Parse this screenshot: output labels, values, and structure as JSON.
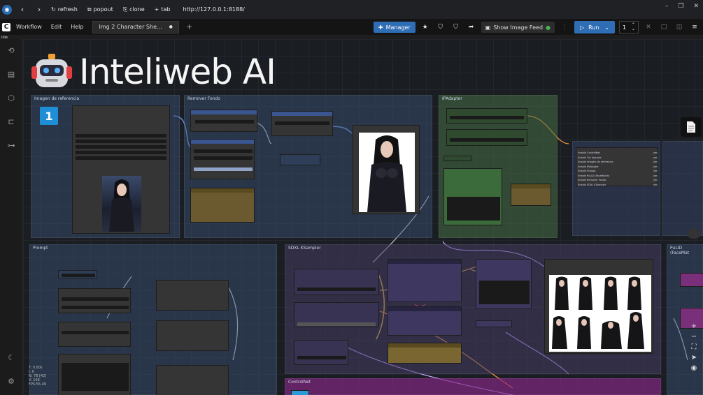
{
  "browser": {
    "back": "‹",
    "forward": "›",
    "buttons": [
      {
        "label": "refresh",
        "icon": "↻"
      },
      {
        "label": "popout",
        "icon": "⧉"
      },
      {
        "label": "clone",
        "icon": "⎘"
      },
      {
        "label": "tab",
        "icon": "+"
      }
    ],
    "url": "http://127.0.0.1:8188/",
    "window_controls": [
      "–",
      "❐",
      "✕"
    ]
  },
  "menubar": {
    "logo": "C",
    "items": [
      "Workflow",
      "Edit",
      "Help"
    ],
    "tab_label": "Img 2 Character She...",
    "tab_modified": "●",
    "tab_add": "+",
    "manager_label": "Manager",
    "show_image_feed_label": "Show Image Feed",
    "run_label": "Run",
    "run_count": "1",
    "sub_label": "Idle"
  },
  "brand": {
    "title": "Inteliweb AI"
  },
  "groups": {
    "reference": "Imagen de referencia",
    "remove_bg": "Remover Fondo",
    "ipadapter": "IPAdapter",
    "prompt": "Prompt",
    "ksampler": "SDXL KSampler",
    "pulid": "PuLID (FaceMat",
    "controlnet": "ControlNet"
  },
  "badge_number": "1",
  "toggles": [
    {
      "label": "Enable ControlNet",
      "value": "yes"
    },
    {
      "label": "Enable Txt Upscale",
      "value": "yes"
    },
    {
      "label": "Enable Imagen de referencia",
      "value": "yes"
    },
    {
      "label": "Enable IPAdapter",
      "value": "yes"
    },
    {
      "label": "Enable Prompt",
      "value": "yes"
    },
    {
      "label": "Enable PuLID (FaceMatch)",
      "value": "yes"
    },
    {
      "label": "Enable Remover Fondo",
      "value": "yes"
    },
    {
      "label": "Enable SDXL KSampler",
      "value": "yes"
    }
  ],
  "status": {
    "lines": [
      "T: 0.00s",
      "I: 0",
      "N: 78 [42]",
      "V: 166",
      "FPS:55.49"
    ]
  },
  "colors": {
    "accent": "#2f6db5",
    "group_blue": "#2d3d54",
    "group_green": "#3a5a3a",
    "group_purple": "#4a3c5e",
    "group_magenta": "#6b2c6b",
    "badge": "#1e8fd6"
  }
}
